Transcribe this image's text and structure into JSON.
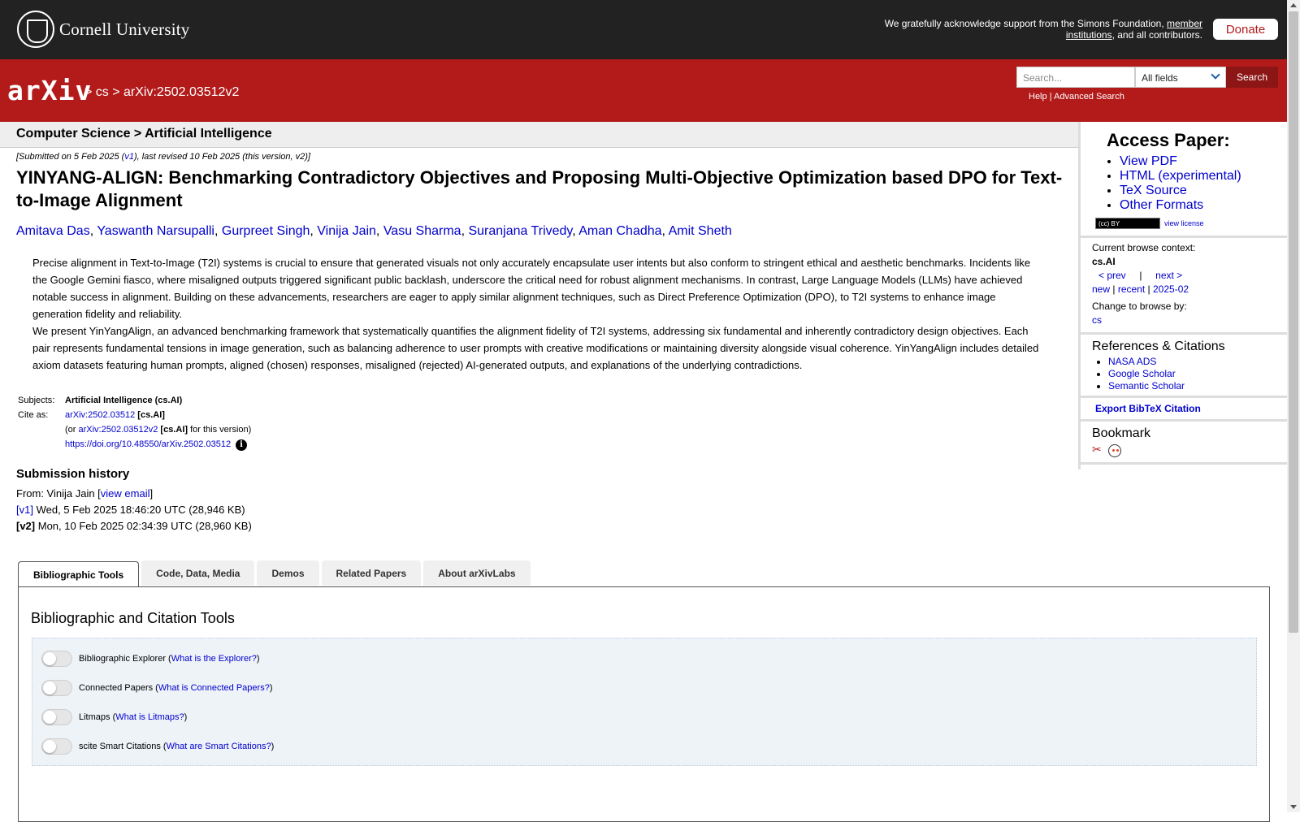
{
  "header": {
    "institution": "Cornell University",
    "ack_text": "We gratefully acknowledge support from the Simons Foundation, ",
    "ack_link": "member institutions",
    "ack_tail": ", and all contributors.",
    "donate_label": "Donate"
  },
  "arxiv_bar": {
    "logo_text": "arXiv",
    "breadcrumb": "> cs > arXiv:2502.03512v2",
    "search_placeholder": "Search...",
    "search_field_selected": "All fields",
    "search_button": "Search",
    "help_link": "Help",
    "advanced_link": "Advanced Search",
    "help_sep": "|"
  },
  "subheader": {
    "category": "Computer Science > Artificial Intelligence"
  },
  "paper": {
    "submitted_pre": "[Submitted on 5 Feb 2025 (",
    "submitted_v1": "v1",
    "submitted_post": "), last revised 10 Feb 2025 (this version, v2)]",
    "title": "YINYANG-ALIGN: Benchmarking Contradictory Objectives and Proposing Multi-Objective Optimization based DPO for Text-to-Image Alignment",
    "authors": [
      "Amitava Das",
      "Yaswanth Narsupalli",
      "Gurpreet Singh",
      "Vinija Jain",
      "Vasu Sharma",
      "Suranjana Trivedy",
      "Aman Chadha",
      "Amit Sheth"
    ],
    "abstract_p1": "Precise alignment in Text-to-Image (T2I) systems is crucial to ensure that generated visuals not only accurately encapsulate user intents but also conform to stringent ethical and aesthetic benchmarks. Incidents like the Google Gemini fiasco, where misaligned outputs triggered significant public backlash, underscore the critical need for robust alignment mechanisms. In contrast, Large Language Models (LLMs) have achieved notable success in alignment. Building on these advancements, researchers are eager to apply similar alignment techniques, such as Direct Preference Optimization (DPO), to T2I systems to enhance image generation fidelity and reliability.",
    "abstract_p2": "We present YinYangAlign, an advanced benchmarking framework that systematically quantifies the alignment fidelity of T2I systems, addressing six fundamental and inherently contradictory design objectives. Each pair represents fundamental tensions in image generation, such as balancing adherence to user prompts with creative modifications or maintaining diversity alongside visual coherence. YinYangAlign includes detailed axiom datasets featuring human prompts, aligned (chosen) responses, misaligned (rejected) AI-generated outputs, and explanations of the underlying contradictions.",
    "subjects_label": "Subjects:",
    "subjects_value": "Artificial Intelligence (cs.AI)",
    "cite_label": "Cite as:",
    "cite_id": "arXiv:2502.03512",
    "cite_cat": "[cs.AI]",
    "cite_or_pre": "(or ",
    "cite_version_id": "arXiv:2502.03512v2",
    "cite_version_cat": "[cs.AI]",
    "cite_or_post": " for this version)",
    "doi": "https://doi.org/10.48550/arXiv.2502.03512",
    "info_icon": "i"
  },
  "submission_history": {
    "heading": "Submission history",
    "from_pre": "From: Vinija Jain [",
    "from_link": "view email",
    "from_post": "]",
    "v1_label": "[v1]",
    "v1_text": " Wed, 5 Feb 2025 18:46:20 UTC (28,946 KB)",
    "v2_label": "[v2]",
    "v2_text": " Mon, 10 Feb 2025 02:34:39 UTC (28,960 KB)"
  },
  "sidebar": {
    "access_title": "Access Paper:",
    "access_links": [
      "View PDF",
      "HTML (experimental)",
      "TeX Source",
      "Other Formats"
    ],
    "cc_badge": "(cc) BY",
    "view_license": "view license",
    "context_label": "Current browse context:",
    "context_value": "cs.AI",
    "prev": "< prev",
    "nav_sep": "|",
    "next": "next >",
    "new": "new",
    "recent": "recent",
    "month": "2025-02",
    "change_label": "Change to browse by:",
    "change_value": "cs",
    "refs_title": "References & Citations",
    "refs_links": [
      "NASA ADS",
      "Google Scholar",
      "Semantic Scholar"
    ],
    "bibtex": "Export BibTeX Citation",
    "bookmark_title": "Bookmark"
  },
  "tabs": {
    "items": [
      "Bibliographic Tools",
      "Code, Data, Media",
      "Demos",
      "Related Papers",
      "About arXivLabs"
    ],
    "panel_title": "Bibliographic and Citation Tools",
    "tools": [
      {
        "label": "Bibliographic Explorer (",
        "link": "What is the Explorer?",
        "tail": ")"
      },
      {
        "label": "Connected Papers (",
        "link": "What is Connected Papers?",
        "tail": ")"
      },
      {
        "label": "Litmaps (",
        "link": "What is Litmaps?",
        "tail": ")"
      },
      {
        "label": "scite Smart Citations (",
        "link": "What are Smart Citations?",
        "tail": ")"
      }
    ]
  }
}
